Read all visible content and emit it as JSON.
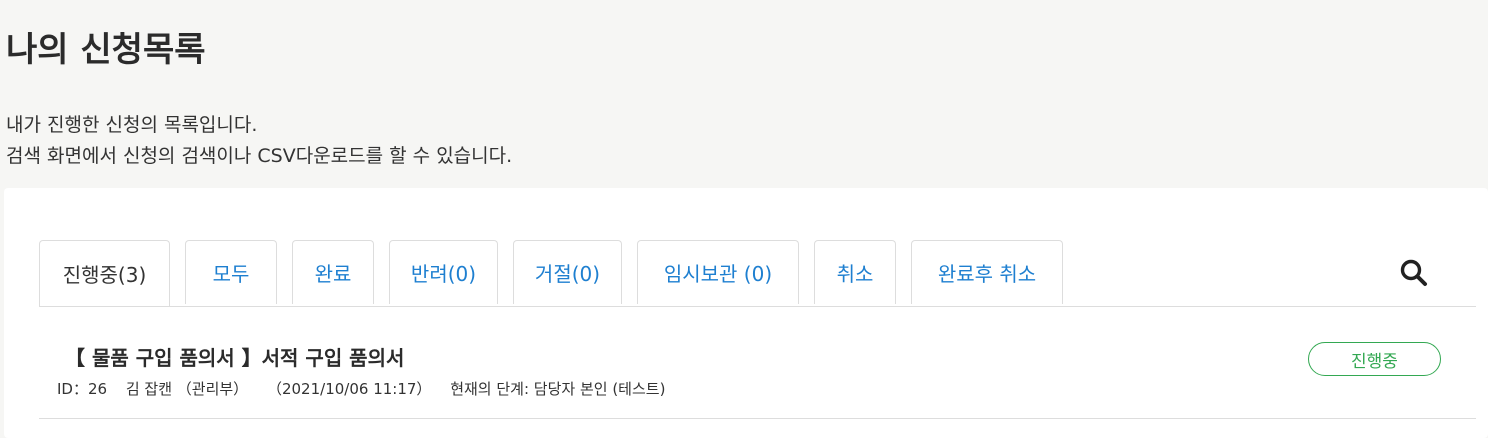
{
  "page": {
    "title": "나의 신청목록",
    "description_line1": "내가 진행한 신청의 목록입니다.",
    "description_line2": "검색 화면에서 신청의 검색이나 CSV다운로드를 할 수 있습니다."
  },
  "tabs": [
    {
      "label": "진행중(3)",
      "active": true
    },
    {
      "label": "모두",
      "active": false
    },
    {
      "label": "완료",
      "active": false
    },
    {
      "label": "반려(0)",
      "active": false
    },
    {
      "label": "거절(0)",
      "active": false
    },
    {
      "label": "임시보관 (0)",
      "active": false
    },
    {
      "label": "취소",
      "active": false
    },
    {
      "label": "완료후 취소",
      "active": false
    }
  ],
  "search": {
    "icon": "search-icon"
  },
  "items": [
    {
      "title": "【 물품 구입 품의서 】서적 구입 품의서",
      "id": "ID：26",
      "applicant": "김 잡캔 （관리부）",
      "datetime": "（2021/10/06 11:17）",
      "stage": "현재의 단계: 담당자 본인 (테스트)",
      "status": "진행중"
    }
  ],
  "colors": {
    "background": "#f6f6f4",
    "link": "#1e7fd0",
    "status_green": "#33a852",
    "border": "#dddddd"
  }
}
